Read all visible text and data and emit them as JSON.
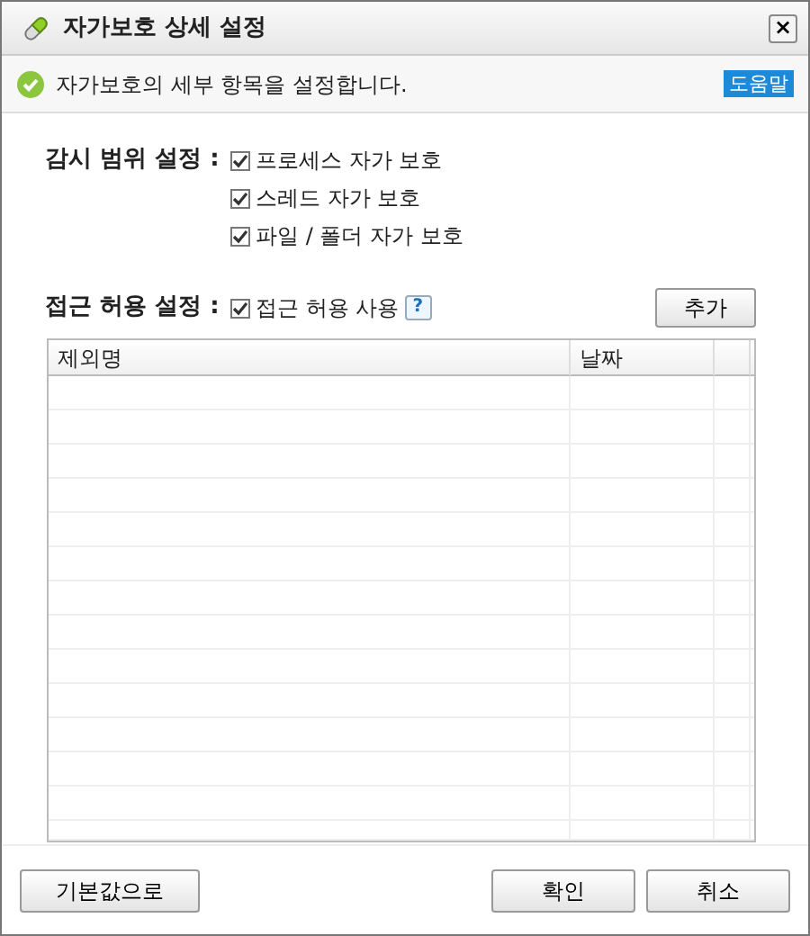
{
  "window": {
    "title": "자가보호 상세 설정",
    "close": "×"
  },
  "info": {
    "message": "자가보호의 세부 항목을 설정합니다.",
    "help": "도움말"
  },
  "monitor_scope": {
    "label": "감시 범위 설정 :",
    "options": [
      {
        "label": "프로세스 자가 보호",
        "checked": true
      },
      {
        "label": "스레드 자가 보호",
        "checked": true
      },
      {
        "label": "파일 / 폴더 자가 보호",
        "checked": true
      }
    ]
  },
  "access": {
    "label": "접근 허용 설정 :",
    "option": {
      "label": "접근 허용 사용",
      "checked": true
    },
    "help": "?",
    "add_button": "추가"
  },
  "table": {
    "columns": [
      "제외명",
      "날짜"
    ]
  },
  "buttons": {
    "defaults": "기본값으로",
    "ok": "확인",
    "cancel": "취소"
  }
}
